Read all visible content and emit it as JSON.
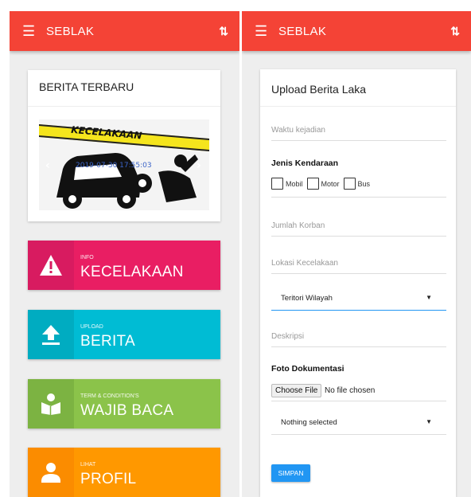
{
  "app": {
    "title": "SEBLAK",
    "menu_icon": "hamburger-icon",
    "sort_icon": "swap-vertical-icon"
  },
  "left": {
    "news": {
      "title": "BERITA TERBARU",
      "banner_text": "KECELAKAAN",
      "date": "2019-07-30 17:55:03"
    },
    "tiles": [
      {
        "sub": "INFO",
        "label": "KECELAKAAN",
        "icon": "warning-icon",
        "color": "#e91e63"
      },
      {
        "sub": "UPLOAD",
        "label": "BERITA",
        "icon": "upload-icon",
        "color": "#00bcd4"
      },
      {
        "sub": "TERM & CONDITION'S",
        "label": "WAJIB BACA",
        "icon": "book-reader-icon",
        "color": "#8bc34a"
      },
      {
        "sub": "LIHAT",
        "label": "PROFIL",
        "icon": "person-icon",
        "color": "#ff9800"
      }
    ]
  },
  "form": {
    "title": "Upload Berita Laka",
    "waktu_placeholder": "Waktu kejadian",
    "jenis_label": "Jenis Kendaraan",
    "options": [
      "Mobil",
      "Motor",
      "Bus"
    ],
    "jumlah_placeholder": "Jumlah Korban",
    "lokasi_placeholder": "Lokasi Kecelakaan",
    "teritori_value": "Teritori Wilayah",
    "deskripsi_placeholder": "Deskripsi",
    "foto_label": "Foto Dokumentasi",
    "choose_file": "Choose File",
    "no_file": "No file chosen",
    "nothing_selected": "Nothing selected",
    "submit": "SIMPAN"
  },
  "colors": {
    "appbar": "#f44336",
    "accent": "#2196f3"
  }
}
